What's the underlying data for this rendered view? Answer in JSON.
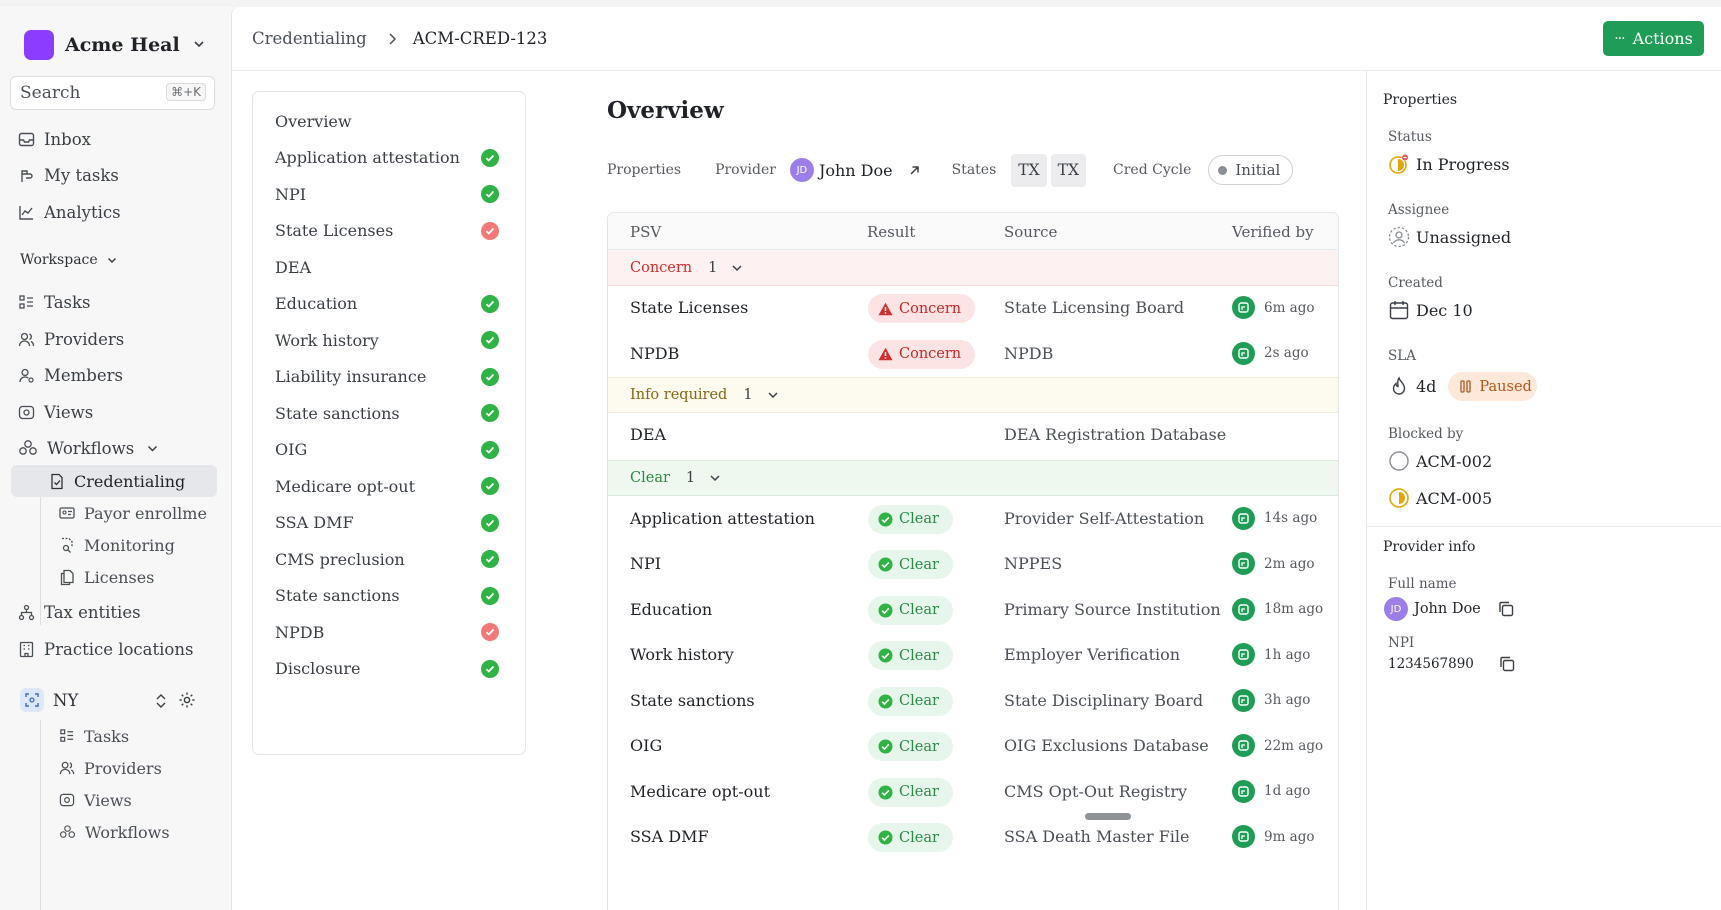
{
  "sidebar": {
    "org_name": "Acme Heal",
    "search_placeholder": "Search",
    "search_shortcut": "⌘+K",
    "top_items": [
      {
        "label": "Inbox",
        "icon": "inbox-icon"
      },
      {
        "label": "My tasks",
        "icon": "hand-icon"
      },
      {
        "label": "Analytics",
        "icon": "chart-line-icon"
      }
    ],
    "workspace_label": "Workspace",
    "workspace_items": [
      {
        "label": "Tasks",
        "icon": "tasks-icon"
      },
      {
        "label": "Providers",
        "icon": "users-icon"
      },
      {
        "label": "Members",
        "icon": "members-icon"
      },
      {
        "label": "Views",
        "icon": "eye-icon"
      }
    ],
    "workflows_label": "Workflows",
    "workflow_items": [
      {
        "label": "Credentialing",
        "icon": "file-check-icon",
        "active": true
      },
      {
        "label": "Payor enrollme",
        "icon": "id-card-icon"
      },
      {
        "label": "Monitoring",
        "icon": "file-search-icon"
      },
      {
        "label": "Licenses",
        "icon": "files-icon"
      }
    ],
    "more_items": [
      {
        "label": "Tax entities",
        "icon": "network-icon"
      },
      {
        "label": "Practice locations",
        "icon": "building-icon"
      }
    ],
    "team_name": "NY",
    "team_items": [
      {
        "label": "Tasks",
        "icon": "tasks-icon"
      },
      {
        "label": "Providers",
        "icon": "users-icon"
      },
      {
        "label": "Views",
        "icon": "eye-icon"
      },
      {
        "label": "Workflows",
        "icon": "workflows-icon"
      }
    ]
  },
  "header": {
    "breadcrumb_parent": "Credentialing",
    "breadcrumb_current": "ACM-CRED-123",
    "actions_label": "Actions"
  },
  "checklist": [
    {
      "label": "Overview",
      "status": "none"
    },
    {
      "label": "Application attestation",
      "status": "ok"
    },
    {
      "label": "NPI",
      "status": "ok"
    },
    {
      "label": "State Licenses",
      "status": "bad"
    },
    {
      "label": "DEA",
      "status": "none"
    },
    {
      "label": "Education",
      "status": "ok"
    },
    {
      "label": "Work history",
      "status": "ok"
    },
    {
      "label": "Liability insurance",
      "status": "ok"
    },
    {
      "label": "State sanctions",
      "status": "ok"
    },
    {
      "label": "OIG",
      "status": "ok"
    },
    {
      "label": "Medicare opt-out",
      "status": "ok"
    },
    {
      "label": "SSA DMF",
      "status": "ok"
    },
    {
      "label": "CMS preclusion",
      "status": "ok"
    },
    {
      "label": "State sanctions",
      "status": "ok"
    },
    {
      "label": "NPDB",
      "status": "bad"
    },
    {
      "label": "Disclosure",
      "status": "ok"
    }
  ],
  "overview": {
    "title": "Overview",
    "properties_label": "Properties",
    "provider_label": "Provider",
    "provider_initials": "JD",
    "provider_name": "John Doe",
    "states_label": "States",
    "states": [
      "TX",
      "TX"
    ],
    "cred_cycle_label": "Cred Cycle",
    "cred_cycle_value": "Initial"
  },
  "table": {
    "columns": [
      "PSV",
      "Result",
      "Source",
      "Verified by"
    ],
    "groups": {
      "concern": {
        "label": "Concern",
        "count": "1"
      },
      "info": {
        "label": "Info required",
        "count": "1"
      },
      "clear": {
        "label": "Clear",
        "count": "1"
      }
    },
    "concern_rows": [
      {
        "psv": "State Licenses",
        "result": "Concern",
        "source": "State Licensing Board",
        "verified": "6m ago"
      },
      {
        "psv": "NPDB",
        "result": "Concern",
        "source": "NPDB",
        "verified": "2s ago"
      }
    ],
    "info_rows": [
      {
        "psv": "DEA",
        "source": "DEA Registration Database"
      }
    ],
    "clear_rows": [
      {
        "psv": "Application attestation",
        "result": "Clear",
        "source": "Provider Self-Attestation",
        "verified": "14s ago"
      },
      {
        "psv": "NPI",
        "result": "Clear",
        "source": "NPPES",
        "verified": "2m ago"
      },
      {
        "psv": "Education",
        "result": "Clear",
        "source": "Primary Source Institution",
        "verified": "18m ago"
      },
      {
        "psv": "Work history",
        "result": "Clear",
        "source": "Employer Verification",
        "verified": "1h ago"
      },
      {
        "psv": "State sanctions",
        "result": "Clear",
        "source": "State Disciplinary Board",
        "verified": "3h ago"
      },
      {
        "psv": "OIG",
        "result": "Clear",
        "source": "OIG Exclusions Database",
        "verified": "22m ago"
      },
      {
        "psv": "Medicare opt-out",
        "result": "Clear",
        "source": "CMS Opt-Out Registry",
        "verified": "1d ago"
      },
      {
        "psv": "SSA DMF",
        "result": "Clear",
        "source": "SSA Death Master File",
        "verified": "9m ago"
      }
    ]
  },
  "properties": {
    "heading": "Properties",
    "status_label": "Status",
    "status_value": "In Progress",
    "assignee_label": "Assignee",
    "assignee_value": "Unassigned",
    "created_label": "Created",
    "created_value": "Dec 10",
    "sla_label": "SLA",
    "sla_value": "4d",
    "sla_state": "Paused",
    "blocked_label": "Blocked by",
    "blocked_items": [
      "ACM-002",
      "ACM-005"
    ],
    "provider_info_heading": "Provider info",
    "full_name_label": "Full name",
    "full_name_initials": "JD",
    "full_name_value": "John Doe",
    "npi_label": "NPI",
    "npi_value": "1234567890"
  },
  "colors": {
    "accent_green": "#1f9d57",
    "concern_red": "#d12c2c",
    "brand_purple": "#8b3dff"
  }
}
